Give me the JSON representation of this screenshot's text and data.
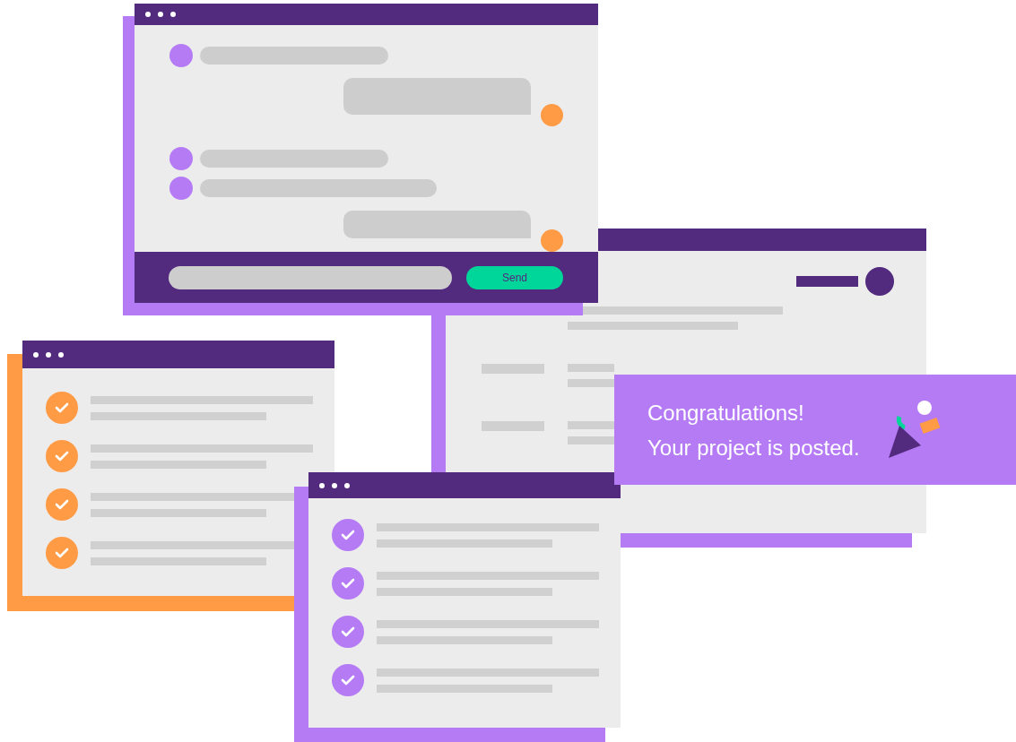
{
  "chat_window": {
    "messages": [
      {
        "kind": "incoming"
      },
      {
        "kind": "outgoing"
      },
      {
        "kind": "incoming"
      },
      {
        "kind": "incoming"
      },
      {
        "kind": "outgoing"
      }
    ],
    "send_button": "Send"
  },
  "checklists": [
    {
      "color": "#ff9a45",
      "items": [
        {
          "checked": true
        },
        {
          "checked": true
        },
        {
          "checked": true
        },
        {
          "checked": true
        }
      ]
    },
    {
      "color": "#b57bf5",
      "items": [
        {
          "checked": true
        },
        {
          "checked": true
        },
        {
          "checked": true
        },
        {
          "checked": true
        }
      ]
    }
  ],
  "notification": {
    "lines": [
      "Congratulations!",
      "Your project is posted."
    ]
  }
}
